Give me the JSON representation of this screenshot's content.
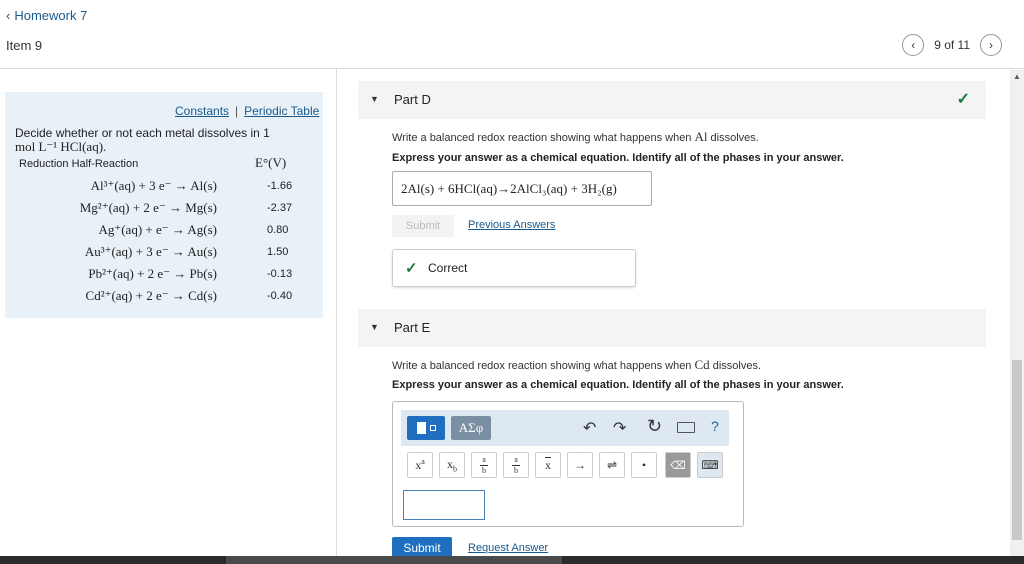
{
  "header": {
    "back_label": "Homework 7",
    "back_icon": "chevron-left-icon",
    "item_title": "Item 9",
    "pager_text": "9 of 11"
  },
  "info_panel": {
    "links": {
      "constants": "Constants",
      "separator": "|",
      "periodic_table": "Periodic Table"
    },
    "intro_text": "Decide whether or not each metal dissolves in 1",
    "intro_conc": "mol L⁻¹ HCl(aq).",
    "table_head_left": "Reduction Half-Reaction",
    "table_head_right": "E°(V)",
    "reactions": [
      {
        "eq": "Al³⁺(aq) + 3 e⁻ → Al(s)",
        "value": "-1.66"
      },
      {
        "eq": "Mg²⁺(aq) + 2 e⁻ → Mg(s)",
        "value": "-2.37"
      },
      {
        "eq": "Ag⁺(aq) + e⁻ → Ag(s)",
        "value": "0.80"
      },
      {
        "eq": "Au³⁺(aq) + 3 e⁻ → Au(s)",
        "value": "1.50"
      },
      {
        "eq": "Pb²⁺(aq) + 2 e⁻ → Pb(s)",
        "value": "-0.13"
      },
      {
        "eq": "Cd²⁺(aq) + 2 e⁻ → Cd(s)",
        "value": "-0.40"
      }
    ]
  },
  "part_d": {
    "label": "Part D",
    "prompt_before": "Write a balanced redox reaction showing what happens when ",
    "prompt_el": "Al",
    "prompt_after": " dissolves.",
    "instruction": "Express your answer as a chemical equation. Identify all of the phases in your answer.",
    "answer": "2Al(s) + 6HCl(aq)→2AlCl₃(aq) + 3H₂(g)",
    "submit_label": "Submit",
    "previous_answers_label": "Previous Answers",
    "feedback": "Correct"
  },
  "part_e": {
    "label": "Part E",
    "prompt_before": "Write a balanced redox reaction showing what happens when ",
    "prompt_el": "Cd",
    "prompt_after": " dissolves.",
    "instruction": "Express your answer as a chemical equation. Identify all of the phases in your answer.",
    "greek_label": "ΑΣφ",
    "help_label": "?",
    "submit_label": "Submit",
    "request_answer_label": "Request Answer"
  },
  "colors": {
    "accent": "#1e6fbf",
    "panel_bg": "#e8f1f8",
    "success": "#1b7a3a",
    "link": "#1a5a8c"
  }
}
